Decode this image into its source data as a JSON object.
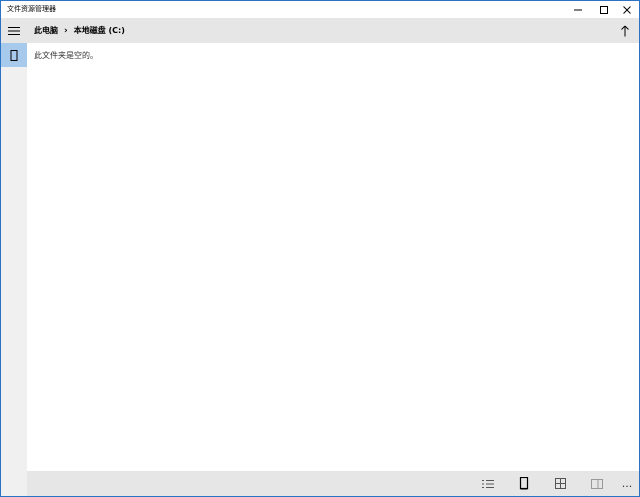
{
  "window": {
    "title": "文件资源管理器",
    "accent": "#2b73c4"
  },
  "header": {
    "breadcrumb": [
      "此电脑",
      "本地磁盘 (C:)"
    ],
    "separator": "›"
  },
  "content": {
    "empty_message": "此文件夹是空的。"
  },
  "icons": {
    "minimize": "minimize-icon",
    "maximize": "maximize-icon",
    "close": "close-icon",
    "menu": "hamburger-icon",
    "up": "arrow-up-icon",
    "sidebar_selected": "phone-device-icon",
    "details": "details-view-icon",
    "device": "device-view-icon",
    "tiles": "tiles-view-icon",
    "more": "more-icon"
  },
  "bottombar": {
    "more_label": "..."
  }
}
